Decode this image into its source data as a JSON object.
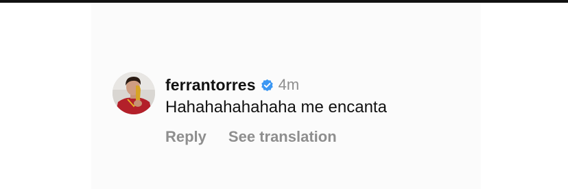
{
  "comment": {
    "username": "ferrantorres",
    "verified_icon": "verified-badge-icon",
    "timestamp": "4m",
    "text": "Hahahahahahaha me encanta",
    "actions": {
      "reply_label": "Reply",
      "translate_label": "See translation"
    }
  },
  "colors": {
    "username": "#111111",
    "muted": "#8e8e8e",
    "verified": "#3b97f3",
    "card_background": "#fbfbfb"
  }
}
